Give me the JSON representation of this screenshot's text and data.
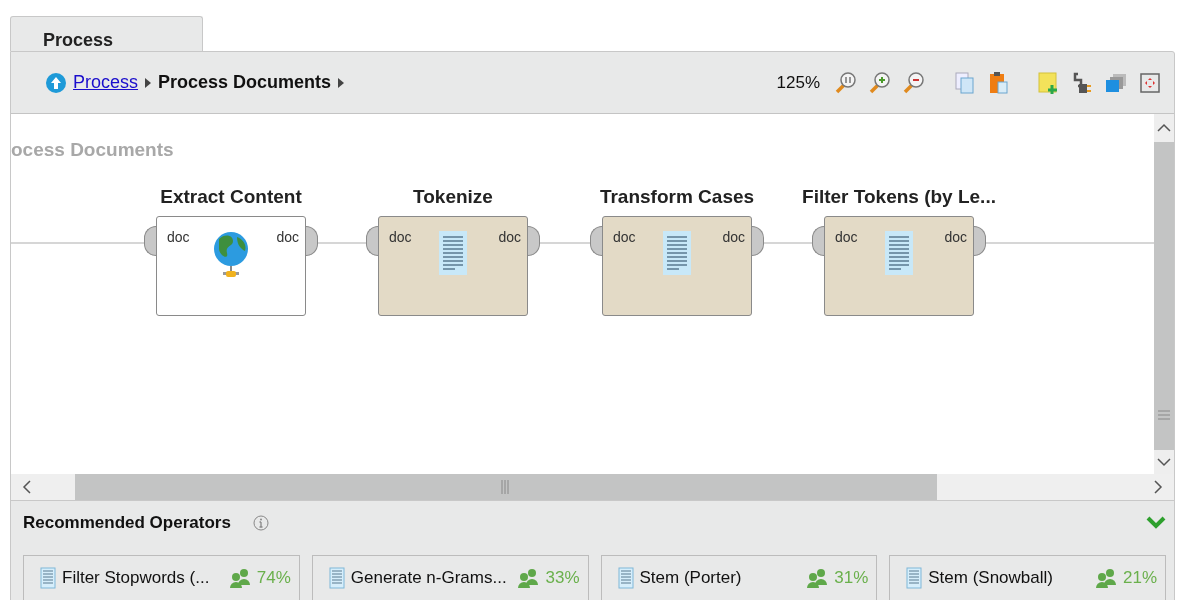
{
  "tabs": [
    {
      "label": "Process",
      "selected": true
    }
  ],
  "breadcrumb": {
    "items": [
      {
        "label": "Process",
        "kind": "link"
      },
      {
        "label": "Process Documents",
        "kind": "current"
      }
    ]
  },
  "toolbar": {
    "zoom": "125%"
  },
  "canvas": {
    "title": "ocess Documents",
    "nodes": [
      {
        "name": "Extract Content",
        "kind": "globe",
        "input": "doc",
        "output": "doc"
      },
      {
        "name": "Tokenize",
        "kind": "document",
        "input": "doc",
        "output": "doc"
      },
      {
        "name": "Transform Cases",
        "kind": "document",
        "input": "doc",
        "output": "doc"
      },
      {
        "name": "Filter Tokens (by Le...",
        "kind": "document",
        "input": "doc",
        "output": "doc"
      }
    ]
  },
  "recommended": {
    "title": "Recommended Operators",
    "operators": [
      {
        "name": "Filter Stopwords (...",
        "share": "74%"
      },
      {
        "name": "Generate n-Grams...",
        "share": "33%"
      },
      {
        "name": "Stem (Porter)",
        "share": "31%"
      },
      {
        "name": "Stem (Snowball)",
        "share": "21%"
      }
    ]
  }
}
